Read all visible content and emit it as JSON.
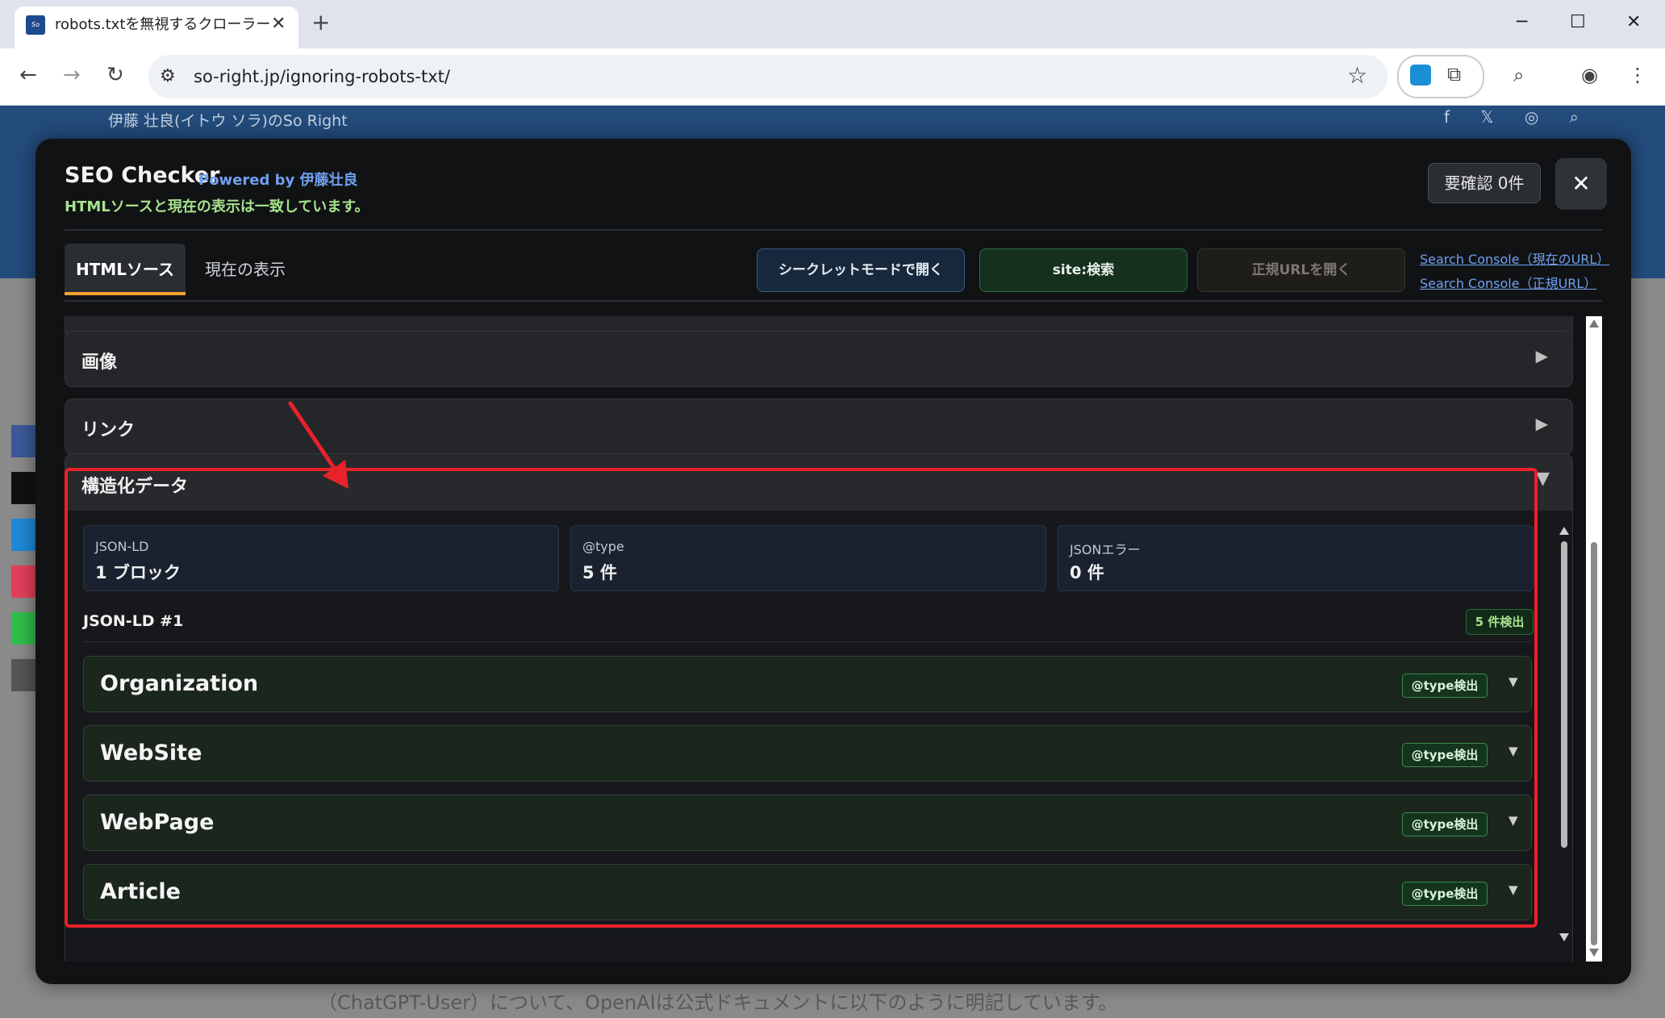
{
  "browser": {
    "tab_title": "robots.txtを無視するクローラーまとめ",
    "favicon_text": "So Right",
    "url": "so-right.jp/ignoring-robots-txt/"
  },
  "page": {
    "header_sub": "伊藤 壮良(イトウ ソラ)のSo Right",
    "body_text": "（ChatGPT-User）について、OpenAIは公式ドキュメントに以下のように明記しています。"
  },
  "modal": {
    "title": "SEO Checker",
    "powered": "Powered by 伊藤壮良",
    "status": "HTMLソースと現在の表示は一致しています。",
    "review_button": "要確認 0件",
    "close_symbol": "✕",
    "tabs": [
      {
        "label": "HTMLソース",
        "active": true
      },
      {
        "label": "現在の表示",
        "active": false
      }
    ],
    "actions": {
      "incognito": "シークレットモードで開く",
      "site_search": "site:検索",
      "canonical": "正規URLを開く"
    },
    "gsc_links": [
      "Search Console（現在のURL）",
      "Search Console（正規URL）"
    ],
    "sections": [
      {
        "label": "画像",
        "expanded": false
      },
      {
        "label": "リンク",
        "expanded": false
      },
      {
        "label": "構造化データ",
        "expanded": true
      }
    ],
    "structured_data": {
      "stats": [
        {
          "label": "JSON-LD",
          "value": "1 ブロック"
        },
        {
          "label": "@type",
          "value": "5 件"
        },
        {
          "label": "JSONエラー",
          "value": "0 件"
        }
      ],
      "block_title": "JSON-LD #1",
      "block_badge": "5 件検出",
      "types": [
        {
          "name": "Organization",
          "badge": "@type検出"
        },
        {
          "name": "WebSite",
          "badge": "@type検出"
        },
        {
          "name": "WebPage",
          "badge": "@type検出"
        },
        {
          "name": "Article",
          "badge": "@type検出"
        }
      ]
    }
  },
  "colors": {
    "modal_bg": "#111214",
    "accent_orange": "#f5a032",
    "link_blue": "#6fa0f0",
    "status_green": "#a6e38d",
    "annotation_red": "#e8222a"
  }
}
